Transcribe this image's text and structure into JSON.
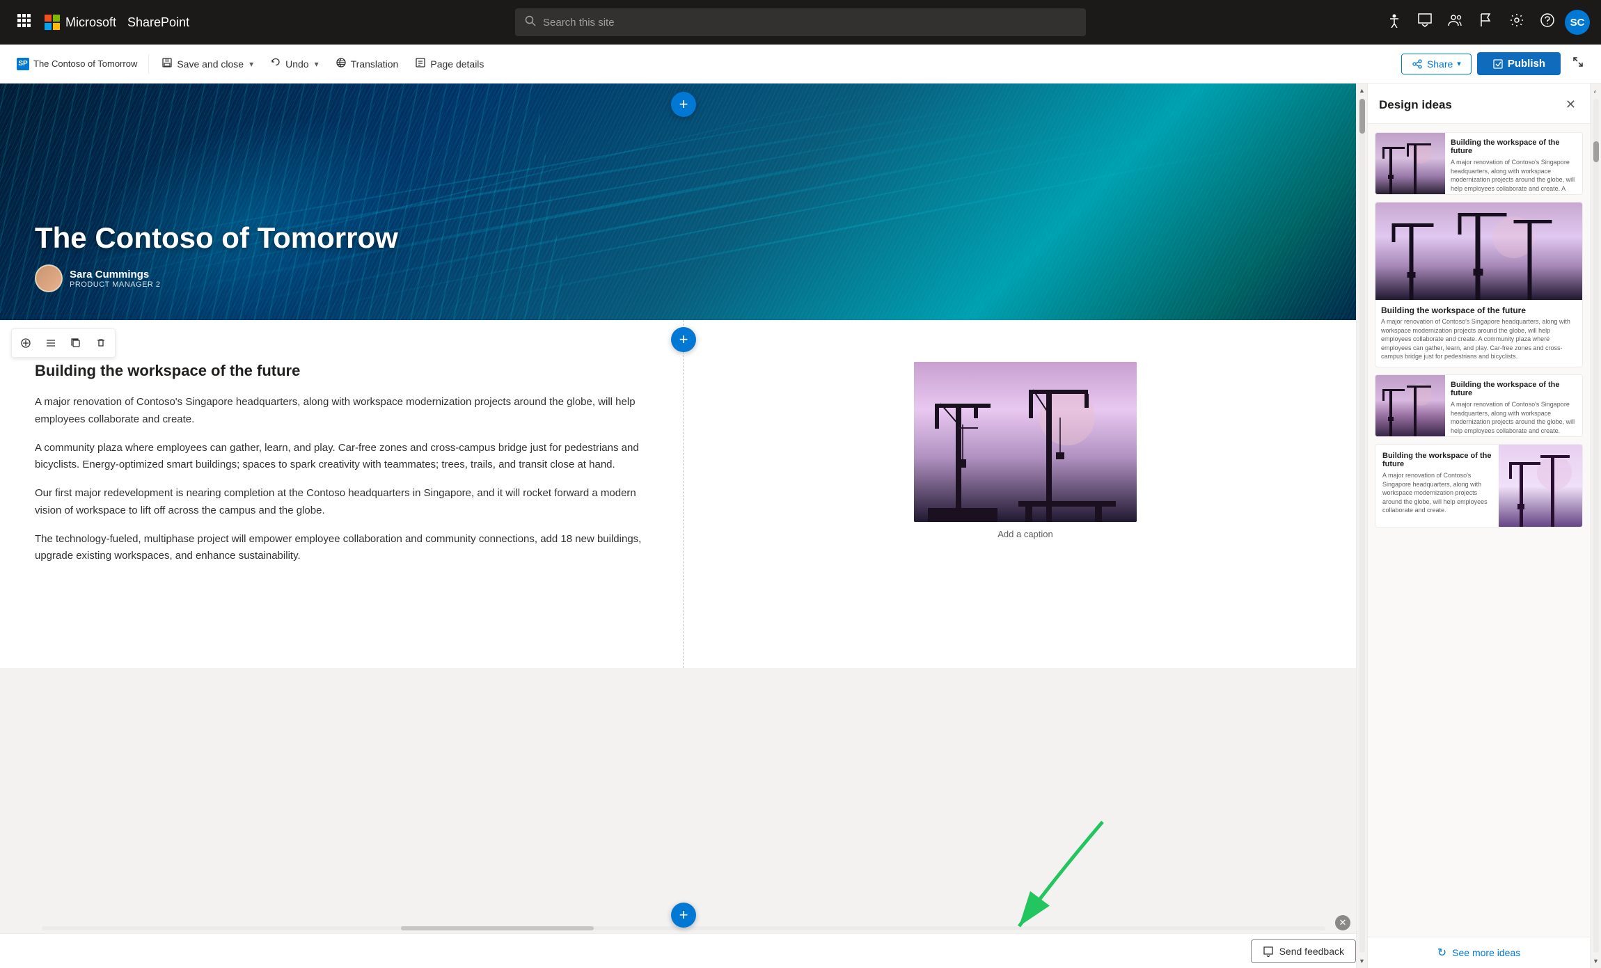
{
  "topnav": {
    "waffle_label": "⊞",
    "ms_logo_text": "Microsoft",
    "sharepoint_text": "SharePoint",
    "search_placeholder": "Search this site",
    "avatar_initials": "SC"
  },
  "toolbar": {
    "page_tag_icon": "SP",
    "page_title": "The Contoso of Tomorrow",
    "save_close_label": "Save and close",
    "undo_label": "Undo",
    "translation_label": "Translation",
    "page_details_label": "Page details",
    "share_label": "Share",
    "publish_label": "Publish",
    "dropdown_arrow": "▾",
    "collapse_icon": "↗"
  },
  "hero": {
    "title": "The Contoso of Tomorrow",
    "author_name": "Sara Cummings",
    "author_role": "PRODUCT MANAGER 2"
  },
  "content": {
    "heading": "Building the workspace of the future",
    "paragraph1": "A major renovation of Contoso's Singapore headquarters, along with workspace modernization projects around the globe, will help employees collaborate and create.",
    "paragraph2": "A community plaza where employees can gather, learn, and play. Car-free zones and cross-campus bridge just for pedestrians and bicyclists. Energy-optimized smart buildings; spaces to spark creativity with teammates; trees, trails, and transit close at hand.",
    "paragraph3": "Our first major redevelopment is nearing completion at the Contoso headquarters in Singapore, and it will rocket forward a modern vision of workspace to lift off across the campus and the globe.",
    "paragraph4": "The technology-fueled, multiphase project will empower employee collaboration and community connections, add 18 new buildings, upgrade existing workspaces, and enhance sustainability.",
    "image_caption": "Add a caption"
  },
  "design_panel": {
    "title": "Design ideas",
    "close_icon": "✕",
    "card1_title": "Building the workspace of the future",
    "card1_body": "A major renovation of Contoso's Singapore headquarters, along with workspace modernization projects around the globe, will help employees collaborate and create. A community plaza where employees can gather, learn, and play. Car-free zones and cross-campus bridge just for pedestrians and bicyclists.",
    "card2_title": "Building the workspace of the future",
    "card2_body": "A major renovation of Contoso's Singapore headquarters, along with workspace modernization projects around the globe, will help employees collaborate and create. A community plaza where employees can gather, learn, and play. Car-free zones and cross-campus bridge just for pedestrians and bicyclists.",
    "card3_title": "Building the workspace of the future",
    "card3_body": "A major renovation of Contoso's Singapore headquarters, along with workspace modernization projects around the globe, will help employees collaborate and create.",
    "card4_title": "Building the workspace of the future",
    "card4_body": "A major renovation of Contoso's Singapore headquarters, along with workspace modernization projects around the globe, will help employees collaborate and create.",
    "see_more_label": "See more ideas",
    "send_feedback_label": "Send feedback",
    "refresh_icon": "↻"
  },
  "bottom": {
    "send_feedback_label": "Send feedback",
    "send_feedback_icon": "✉"
  },
  "section_tools": {
    "move_icon": "⊕",
    "settings_icon": "≡",
    "copy_icon": "⧉",
    "delete_icon": "🗑"
  }
}
